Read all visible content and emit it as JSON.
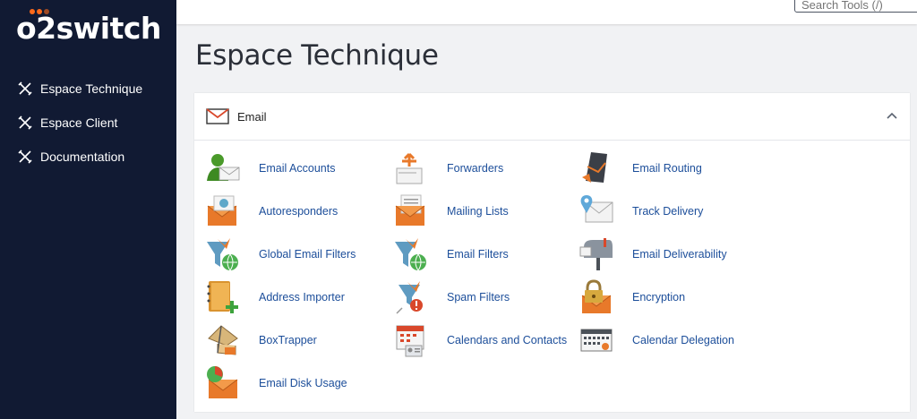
{
  "brand": {
    "logo_text": "o2switch"
  },
  "sidebar": {
    "items": [
      {
        "label": "Espace Technique",
        "icon": "tools-icon"
      },
      {
        "label": "Espace Client",
        "icon": "tools-icon"
      },
      {
        "label": "Documentation",
        "icon": "tools-icon"
      }
    ]
  },
  "search": {
    "placeholder": "Search Tools (/)"
  },
  "page": {
    "title": "Espace Technique"
  },
  "email_section": {
    "title": "Email",
    "icon": "envelope-icon",
    "collapse_icon": "chevron-up-icon",
    "tools": [
      {
        "label": "Email Accounts",
        "icon": "email-accounts-icon"
      },
      {
        "label": "Forwarders",
        "icon": "forwarders-icon"
      },
      {
        "label": "Email Routing",
        "icon": "email-routing-icon"
      },
      {
        "label": "Autoresponders",
        "icon": "autoresponders-icon"
      },
      {
        "label": "Mailing Lists",
        "icon": "mailing-lists-icon"
      },
      {
        "label": "Track Delivery",
        "icon": "track-delivery-icon"
      },
      {
        "label": "Global Email Filters",
        "icon": "global-filters-icon"
      },
      {
        "label": "Email Filters",
        "icon": "email-filters-icon"
      },
      {
        "label": "Email Deliverability",
        "icon": "mailbox-icon"
      },
      {
        "label": "Address Importer",
        "icon": "address-importer-icon"
      },
      {
        "label": "Spam Filters",
        "icon": "spam-filters-icon"
      },
      {
        "label": "Encryption",
        "icon": "padlock-icon"
      },
      {
        "label": "BoxTrapper",
        "icon": "boxtrapper-icon"
      },
      {
        "label": "Calendars and Contacts",
        "icon": "calendar-contacts-icon"
      },
      {
        "label": "Calendar Delegation",
        "icon": "calendar-grid-icon"
      },
      {
        "label": "Email Disk Usage",
        "icon": "disk-usage-icon"
      }
    ]
  },
  "colors": {
    "sidebar_bg": "#111a33",
    "link": "#1c4e9a",
    "logo_accent": "#ff6a1a",
    "envelope_orange": "#e8792a"
  }
}
